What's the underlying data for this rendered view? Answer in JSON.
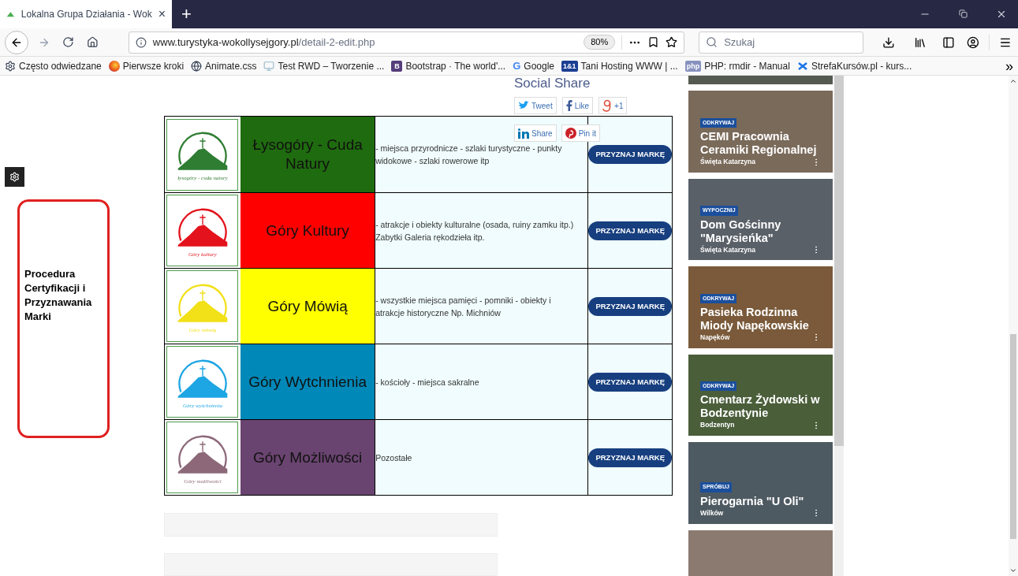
{
  "browser": {
    "tab": {
      "title": "Lokalna Grupa Działania - Wok",
      "close": "×",
      "selected": true
    },
    "new_tab": "+",
    "url": {
      "host": "www.turystyka-wokollysejgory.pl",
      "path": "/detail-2-edit.php",
      "zoom": "80%"
    },
    "search": {
      "placeholder": "Szukaj"
    },
    "bookmarks": [
      {
        "kind": "gear",
        "label": "Często odwiedzane"
      },
      {
        "kind": "firefox",
        "label": "Pierwsze kroki"
      },
      {
        "kind": "globe",
        "label": "Animate.css"
      },
      {
        "kind": "device",
        "label": "Test RWD – Tworzenie ..."
      },
      {
        "kind": "letter",
        "icon_text": "B",
        "color": "#563d7c",
        "label": "Bootstrap · The world'..."
      },
      {
        "kind": "google",
        "icon_text": "G",
        "color": "#4285f4",
        "label": "Google"
      },
      {
        "kind": "letter",
        "icon_text": "1&1",
        "color": "#1c3f94",
        "label": "Tani Hosting WWW | ..."
      },
      {
        "kind": "letter",
        "icon_text": "php",
        "color": "#8892bf",
        "label": "PHP: rmdir - Manual"
      },
      {
        "kind": "strefa",
        "label": "StrefaKursów.pl - kurs..."
      }
    ],
    "bookmarks_more": "»"
  },
  "sidebar": {
    "title": "Procedura Certyfikacji i Przyznawania Marki"
  },
  "social_share": {
    "title": "Social Share",
    "buttons": [
      {
        "kind": "twitter",
        "label": "Tweet"
      },
      {
        "kind": "facebook",
        "label": "Like"
      },
      {
        "kind": "gplus",
        "label": "+1"
      }
    ],
    "buttons_row2": [
      {
        "kind": "linkedin",
        "label": "Share"
      },
      {
        "kind": "pinterest",
        "label": "Pin it"
      }
    ]
  },
  "brands": [
    {
      "logo": {
        "caption": "łysogóry - cuda natury",
        "color": "#2e7d32"
      },
      "name": "Łysogóry - Cuda Natury",
      "color": "#1f6b0f",
      "description": "- miejsca przyrodnicze - szlaki turystyczne - punkty widokowe - szlaki rowerowe itp",
      "button": "PRZYZNAJ MARKĘ"
    },
    {
      "logo": {
        "caption": "Góry kultury",
        "color": "#e3121c"
      },
      "name": "Góry Kultury",
      "color": "#ff0000",
      "description": "- atrakcje i obiekty kulturalne (osada, ruiny zamku itp.) Zabytki Galeria rękodzieła itp.",
      "button": "PRZYZNAJ MARKĘ"
    },
    {
      "logo": {
        "caption": "Góry mówią",
        "color": "#f2e018"
      },
      "name": "Góry Mówią",
      "color": "#ffff00",
      "description": "- wszystkie miejsca pamięci - pomniki - obiekty i atrakcje historyczne Np. Michniów",
      "button": "PRZYZNAJ MARKĘ"
    },
    {
      "logo": {
        "caption": "Góry wytchnienia",
        "color": "#1ea5e3"
      },
      "name": "Góry Wytchnienia",
      "color": "#0088b8",
      "description": "- kościoły - miejsca sakralne",
      "button": "PRZYZNAJ MARKĘ"
    },
    {
      "logo": {
        "caption": "Góry możliwości",
        "color": "#8c6878"
      },
      "name": "Góry Możliwości",
      "color": "#6a4470",
      "description": "Pozostałe",
      "button": "PRZYZNAJ MARKĘ"
    }
  ],
  "places": [
    {
      "tag": "ODKRYWAJ",
      "title": "CEMI Pracownia Ceramiki Regionalnej",
      "location": "Święta Katarzyna",
      "color": "#7a6a5a"
    },
    {
      "tag": "WYPOCZNIJ",
      "title": "Dom Gościnny \"Marysieńka\"",
      "location": "Święta Katarzyna",
      "color": "#5a6068"
    },
    {
      "tag": "ODKRYWAJ",
      "title": "Pasieka Rodzinna Miody Napękowskie",
      "location": "Napęków",
      "color": "#7a5a3a"
    },
    {
      "tag": "ODKRYWAJ",
      "title": "Cmentarz Żydowski w Bodzentynie",
      "location": "Bodzentyn",
      "color": "#4a5e3a"
    },
    {
      "tag": "SPRÓBUJ",
      "title": "Pierogarnia \"U Oli\"",
      "location": "Wilków",
      "color": "#4e5a62"
    }
  ]
}
